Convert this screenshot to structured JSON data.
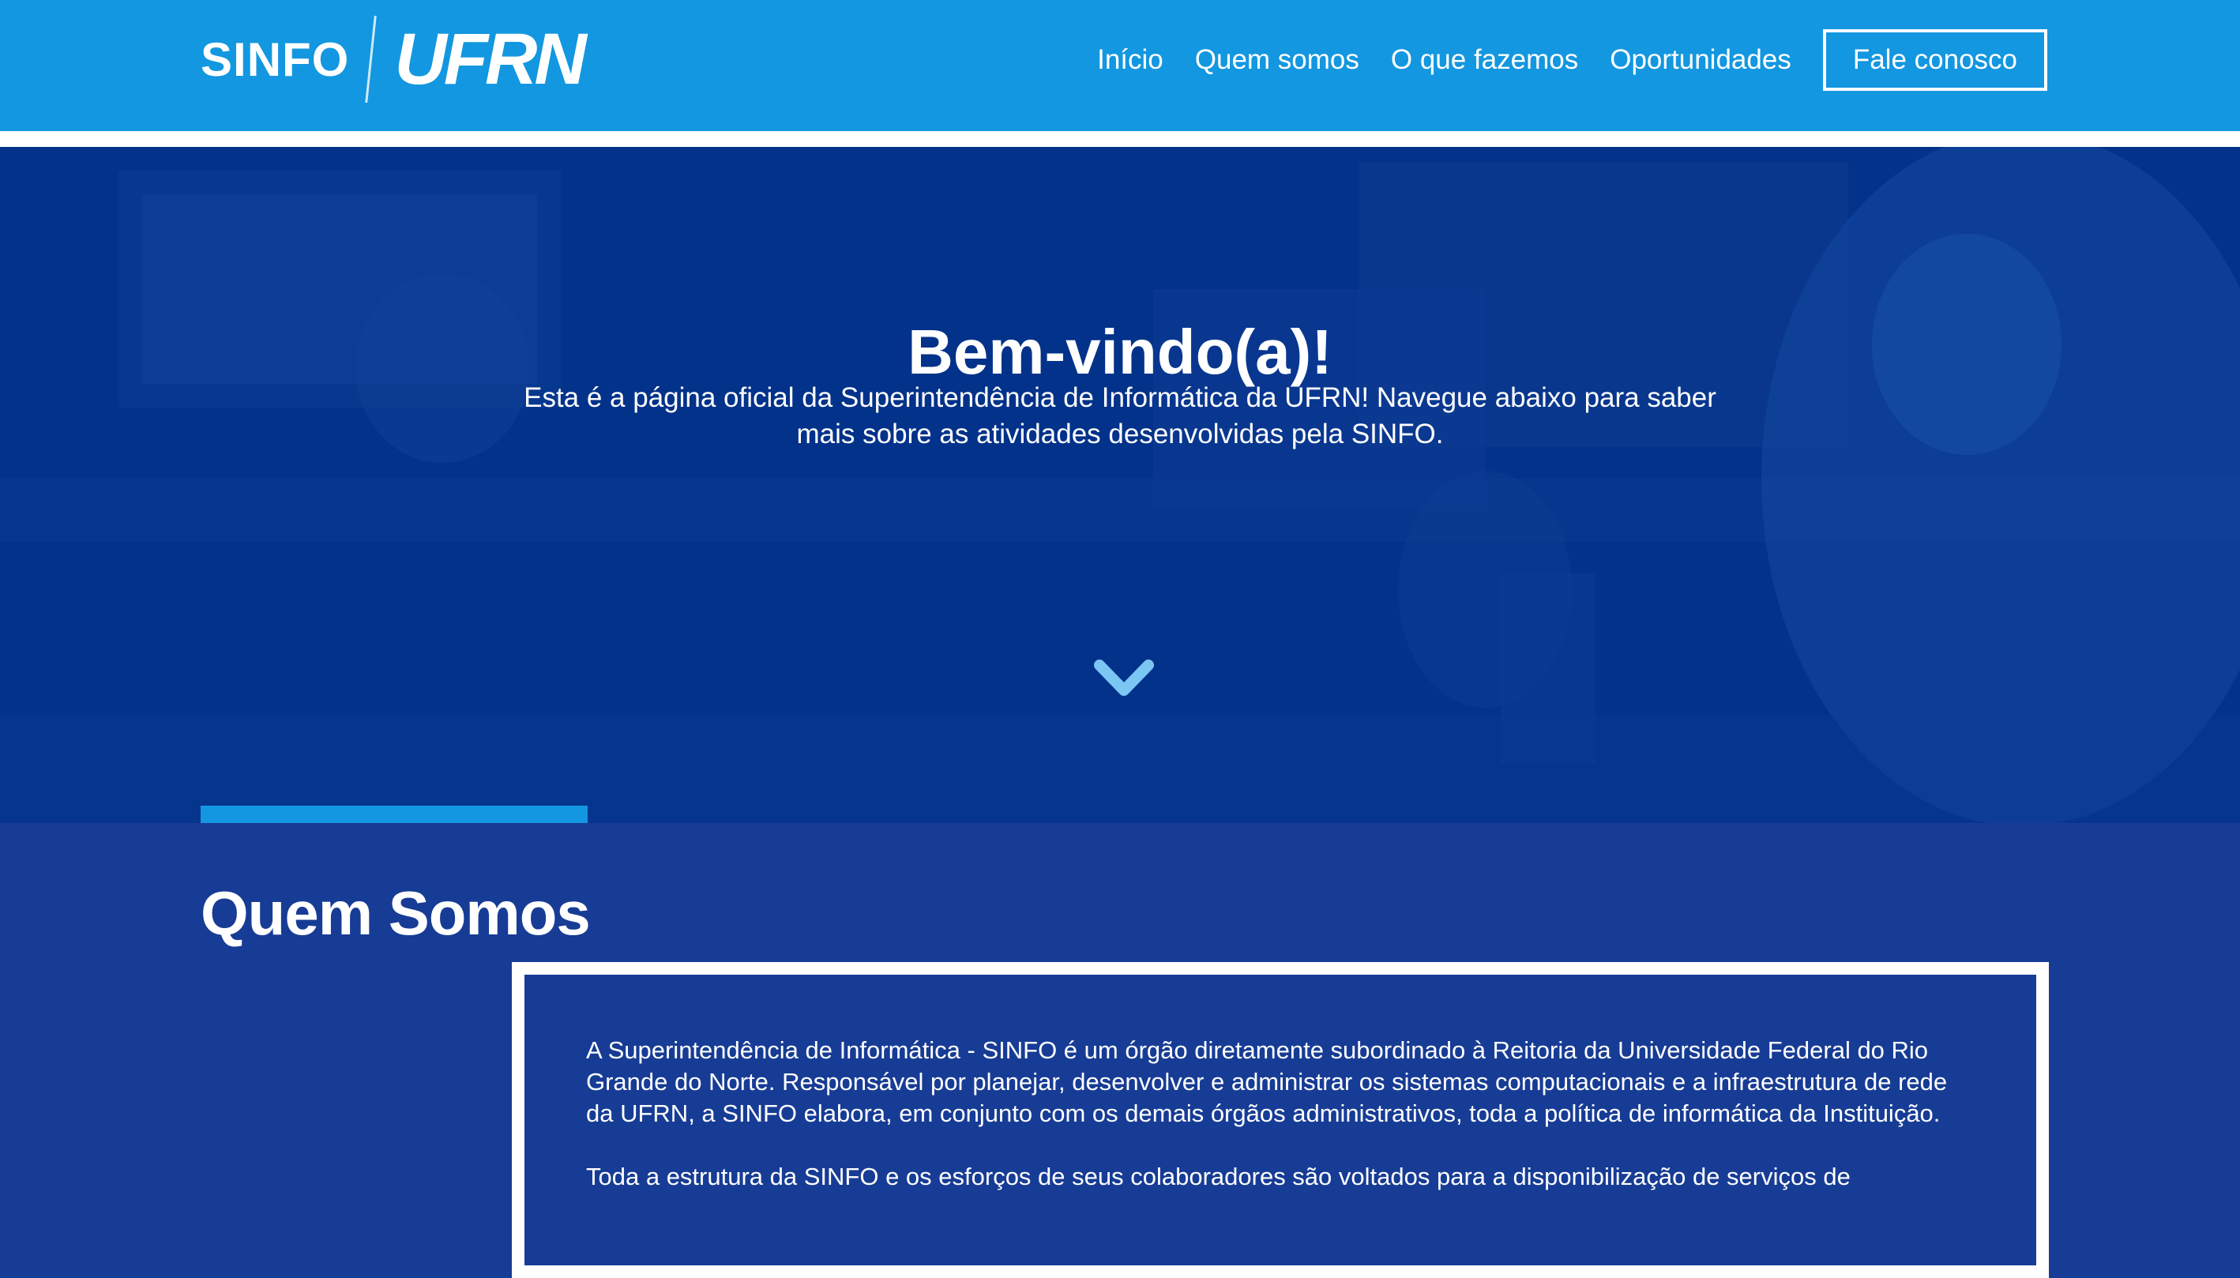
{
  "header": {
    "logo_sinfo": "SINFO",
    "logo_ufrn": "UFRN",
    "nav": [
      "Início",
      "Quem somos",
      "O que fazemos",
      "Oportunidades"
    ],
    "contact_label": "Fale conosco"
  },
  "colors": {
    "header_bg": "#1397e0",
    "hero_bg": "#03328a",
    "section_bg": "#173c95",
    "accent": "#1397e0",
    "chevron": "#7cc6f4"
  },
  "hero": {
    "title": "Bem-vindo(a)!",
    "subtitle": "Esta é a página oficial da Superintendência de Informática da UFRN! Navegue abaixo para saber mais sobre as atividades desenvolvidas pela SINFO.",
    "scroll_icon": "chevron-down-icon"
  },
  "about": {
    "title": "Quem Somos",
    "paragraphs": [
      "A Superintendência de Informática - SINFO é um órgão diretamente subordinado à Reitoria da Universidade Federal do Rio Grande do Norte. Responsável por planejar, desenvolver e administrar os sistemas computacionais e a infraestrutura de rede da UFRN, a SINFO elabora, em conjunto com os demais órgãos administrativos, toda a política de informática da Instituição.",
      "Toda a estrutura da SINFO e os esforços de seus colaboradores são voltados para a disponibilização de serviços de"
    ]
  }
}
